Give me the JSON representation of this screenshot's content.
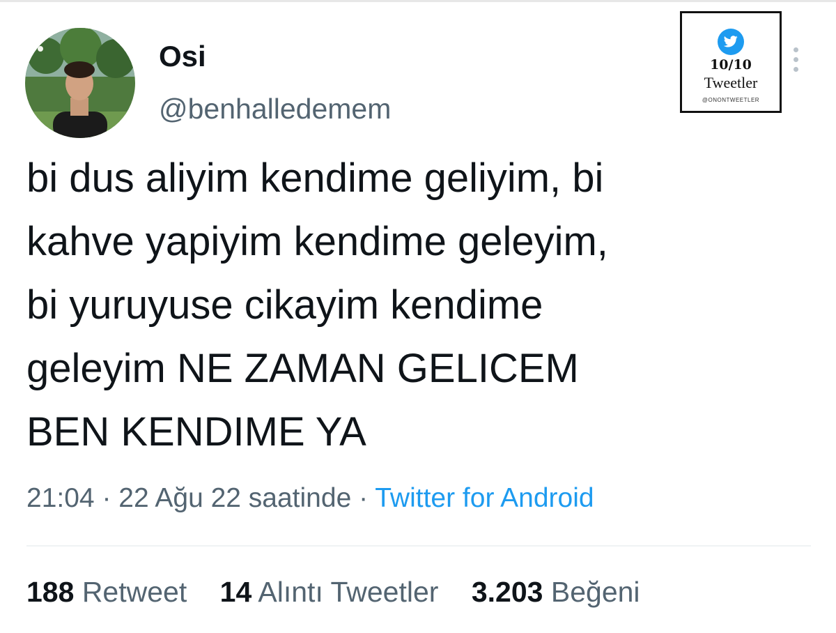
{
  "user": {
    "display_name": "Osi",
    "handle": "@benhalledemem"
  },
  "watermark": {
    "count": "10/10",
    "word": "Tweetler",
    "handle": "@ONONTWEETLER"
  },
  "tweet": {
    "lines": [
      "bi dus aliyim kendime geliyim, bi",
      "kahve yapiyim kendime geleyim,",
      "bi yuruyuse cikayim kendime",
      "geleyim NE ZAMAN GELICEM",
      "BEN KENDIME YA"
    ]
  },
  "meta": {
    "time": "21:04",
    "separator": "·",
    "date": "22 Ağu 22 saatinde",
    "source": "Twitter for Android"
  },
  "stats": {
    "retweets": {
      "count": "188",
      "label": "Retweet"
    },
    "quotes": {
      "count": "14",
      "label": "Alıntı Tweetler"
    },
    "likes": {
      "count": "3.203",
      "label": "Beğeni"
    }
  },
  "colors": {
    "text": "#0f1419",
    "secondary": "#536471",
    "accent": "#1d9bf0",
    "divider": "#eff3f4"
  },
  "icons": {
    "watermark_logo": "twitter-bird-icon",
    "menu": "more-options-icon"
  }
}
